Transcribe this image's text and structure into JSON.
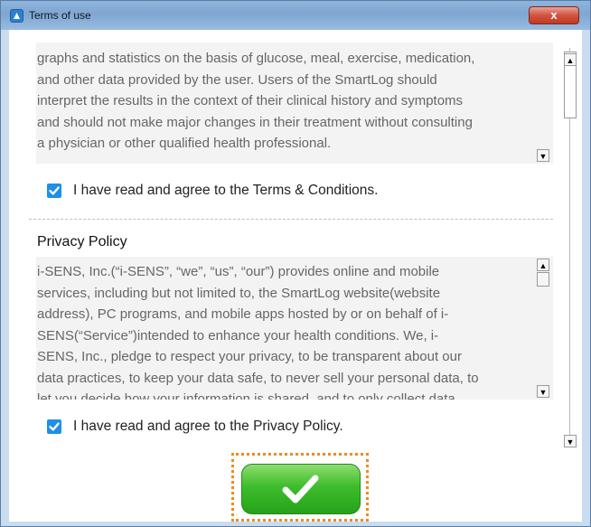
{
  "window": {
    "title": "Terms of use",
    "close_label": "x"
  },
  "terms": {
    "lines": [
      "graphs and statistics on the basis of glucose, meal, exercise, medication,",
      "and other data provided by the user. Users of the SmartLog should",
      "interpret the results in the context of their clinical history and symptoms",
      "and should not make major changes in their treatment without consulting",
      "a physician or other qualified health professional."
    ],
    "checked": true,
    "agree_label": "I have read and agree to the Terms & Conditions."
  },
  "privacy": {
    "heading": "Privacy Policy",
    "lines": [
      "i-SENS, Inc.(“i-SENS”, “we”, “us”, “our”) provides online and mobile",
      "services, including but not limited to, the SmartLog website(website",
      "address), PC programs, and mobile apps hosted by or on behalf of i-",
      "SENS(“Service”)intended to enhance your health conditions. We, i-",
      "SENS, Inc., pledge to respect your privacy, to be transparent about our",
      "data practices, to keep your data safe, to never sell your personal data, to",
      "let you decide how your information is shared, and to only collect data"
    ],
    "checked": true,
    "agree_label": "I have read and agree to the Privacy Policy."
  },
  "confirm": {
    "icon": "checkmark-icon"
  },
  "colors": {
    "checkbox": "#1e90e8",
    "confirm_green": "#3dbd2c",
    "focus_outline": "#f08a1e"
  }
}
